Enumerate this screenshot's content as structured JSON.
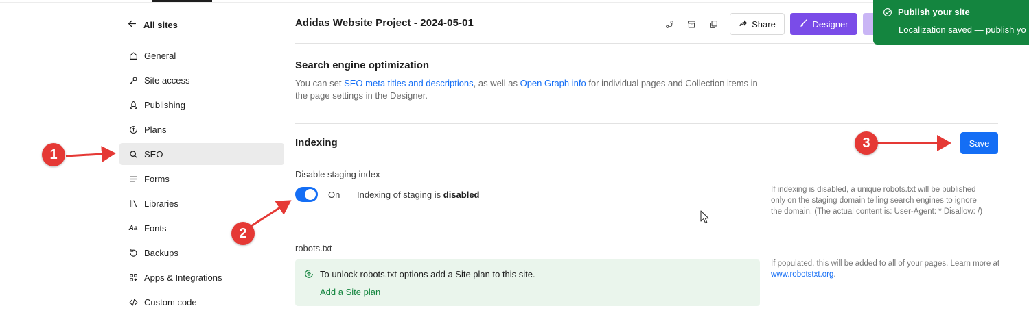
{
  "sidebar": {
    "back_label": "All sites",
    "items": [
      {
        "label": "General",
        "icon": "home-icon"
      },
      {
        "label": "Site access",
        "icon": "key-icon"
      },
      {
        "label": "Publishing",
        "icon": "rocket-icon"
      },
      {
        "label": "Plans",
        "icon": "plan-upgrade-icon"
      },
      {
        "label": "SEO",
        "icon": "search-icon",
        "active": true
      },
      {
        "label": "Forms",
        "icon": "forms-icon"
      },
      {
        "label": "Libraries",
        "icon": "library-icon"
      },
      {
        "label": "Fonts",
        "icon": "fonts-icon"
      },
      {
        "label": "Backups",
        "icon": "backup-icon"
      },
      {
        "label": "Apps & Integrations",
        "icon": "apps-icon"
      },
      {
        "label": "Custom code",
        "icon": "code-icon"
      }
    ]
  },
  "header": {
    "project_title": "Adidas Website Project - 2024-05-01",
    "share_label": "Share",
    "designer_label": "Designer"
  },
  "toast": {
    "title": "Publish your site",
    "message": "Localization saved — publish yo"
  },
  "seo": {
    "title": "Search engine optimization",
    "desc_prefix": "You can set ",
    "desc_link1": "SEO meta titles and descriptions",
    "desc_mid": ", as well as ",
    "desc_link2": "Open Graph info",
    "desc_suffix": " for individual pages and Collection items in the page settings in the Designer."
  },
  "indexing": {
    "title": "Indexing",
    "save_label": "Save",
    "staging_label": "Disable staging index",
    "toggle_state": "On",
    "status_prefix": "Indexing of staging is ",
    "status_value": "disabled",
    "help_text": "If indexing is disabled, a unique robots.txt will be published only on the staging domain telling search engines to ignore the domain. (The actual content is: User-Agent: * Disallow: /)",
    "robots_label": "robots.txt",
    "upgrade_text": "To unlock robots.txt options add a Site plan to this site.",
    "upgrade_link": "Add a Site plan",
    "robots_help_prefix": "If populated, this will be added to all of your pages. Learn more at ",
    "robots_help_link": "www.robotstxt.org",
    "robots_help_suffix": "."
  },
  "annotations": {
    "badge1": "1",
    "badge2": "2",
    "badge3": "3",
    "color": "#e53935"
  },
  "colors": {
    "accent": "#146ef5",
    "designer": "#7a4ce8",
    "toast": "#14853f"
  }
}
